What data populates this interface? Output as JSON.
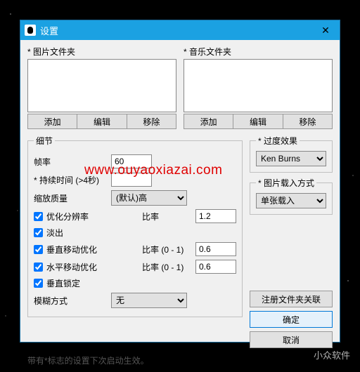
{
  "window": {
    "title": "设置"
  },
  "folders": {
    "image": {
      "label": "* 图片文件夹",
      "add": "添加",
      "edit": "编辑",
      "remove": "移除"
    },
    "music": {
      "label": "* 音乐文件夹",
      "add": "添加",
      "edit": "编辑",
      "remove": "移除"
    }
  },
  "detail": {
    "legend": "细节",
    "fps_label": "帧率",
    "fps_value": "60",
    "duration_label": "* 持续时间 (>4秒)",
    "duration_value": "",
    "quality_label": "缩放质量",
    "quality_value": "(默认)高",
    "optimize_res": "优化分辨率",
    "ratio_label": "比率",
    "ratio_value": "1.2",
    "fade_out": "淡出",
    "v_move_opt": "垂直移动优化",
    "ratio01_label": "比率 (0 - 1)",
    "v_ratio": "0.6",
    "h_move_opt": "水平移动优化",
    "h_ratio": "0.6",
    "v_lock": "垂直锁定",
    "blur_label": "模糊方式",
    "blur_value": "无"
  },
  "transition": {
    "legend": "* 过度效果",
    "value": "Ken Burns"
  },
  "loading": {
    "legend": "* 图片载入方式",
    "value": "单张载入"
  },
  "actions": {
    "register": "注册文件夹关联",
    "ok": "确定",
    "cancel": "取消"
  },
  "footnote": "带有*标志的设置下次启动生效。",
  "watermark_url": "www.ouyaoxiazai.com",
  "watermark_app": "小众软件"
}
